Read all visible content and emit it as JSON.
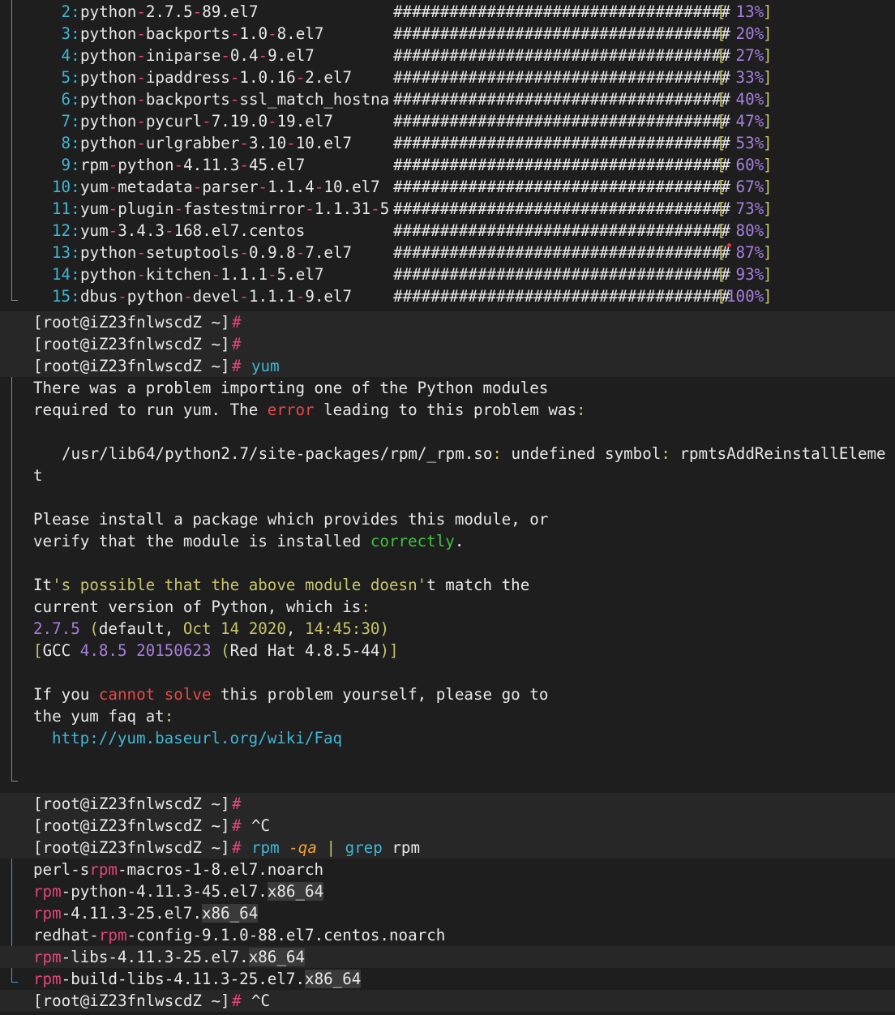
{
  "install_progress": [
    {
      "num": " 2:",
      "pkg": "python-2.7.5-89.el7",
      "bar": "####################################",
      "pct": " 13%"
    },
    {
      "num": " 3:",
      "pkg": "python-backports-1.0-8.el7",
      "bar": "####################################",
      "pct": " 20%"
    },
    {
      "num": " 4:",
      "pkg": "python-iniparse-0.4-9.el7",
      "bar": "####################################",
      "pct": " 27%"
    },
    {
      "num": " 5:",
      "pkg": "python-ipaddress-1.0.16-2.el7",
      "bar": "####################################",
      "pct": " 33%"
    },
    {
      "num": " 6:",
      "pkg": "python-backports-ssl_match_hostna",
      "bar": "####################################",
      "pct": " 40%"
    },
    {
      "num": " 7:",
      "pkg": "python-pycurl-7.19.0-19.el7",
      "bar": "####################################",
      "pct": " 47%"
    },
    {
      "num": " 8:",
      "pkg": "python-urlgrabber-3.10-10.el7",
      "bar": "####################################",
      "pct": " 53%"
    },
    {
      "num": " 9:",
      "pkg": "rpm-python-4.11.3-45.el7",
      "bar": "####################################",
      "pct": " 60%"
    },
    {
      "num": "10:",
      "pkg": "yum-metadata-parser-1.1.4-10.el7",
      "bar": "####################################",
      "pct": " 67%"
    },
    {
      "num": "11:",
      "pkg": "yum-plugin-fastestmirror-1.1.31-5",
      "bar": "####################################",
      "pct": " 73%"
    },
    {
      "num": "12:",
      "pkg": "yum-3.4.3-168.el7.centos",
      "bar": "####################################",
      "pct": " 80%"
    },
    {
      "num": "13:",
      "pkg": "python-setuptools-0.9.8-7.el7",
      "bar": "####################################",
      "pct": " 87%"
    },
    {
      "num": "14:",
      "pkg": "python-kitchen-1.1.1-5.el7",
      "bar": "####################################",
      "pct": " 93%"
    },
    {
      "num": "15:",
      "pkg": "dbus-python-devel-1.1.1-9.el7",
      "bar": "####################################",
      "pct": "100%"
    }
  ],
  "prompt": "[root@iZ23fnlwscdZ ~]",
  "hash": "#",
  "cmd_yum": "yum",
  "yum_error": {
    "l1": "There was a problem importing one of the Python modules",
    "l2a": "required to run yum. The ",
    "l2b": "error",
    "l2c": " leading to this problem was",
    "colon": ":",
    "path": "/usr/lib64/python2.7/site-packages/rpm/_rpm.so",
    "undef": " undefined symbol",
    "sym": " rpmtsAddReinstallEleme",
    "wrap": "t",
    "p1": "Please install a package which provides this module, or",
    "p2a": "verify that the module is installed ",
    "p2b": "correctly",
    "p2c": ".",
    "q1a": "It",
    "q1b": "'s possible that the above module doesn'",
    "q1c": "t match the",
    "q2a": "current version of Python, which is",
    "q2b": ":",
    "v1a": "2.7.5",
    "v1b": " (",
    "v1c": "default, ",
    "v1d": "Oct 14 2020",
    "v1e": ", ",
    "v1f": "14:45:30",
    "v1g": ")",
    "g1a": "[",
    "g1b": "GCC ",
    "g1c": "4.8.5 20150623",
    "g1d": " (",
    "g1e": "Red Hat 4.8.5-44",
    "g1f": ")]",
    "s1a": "If you ",
    "s1b": "cannot solve",
    "s1c": " this problem yourself, please go to",
    "s2a": "the yum faq at",
    "s2b": ":",
    "url": "http://yum.baseurl.org/wiki/Faq"
  },
  "ctrl_c": "^C",
  "cmd_rpm": {
    "rpm": "rpm",
    "flag": "-qa",
    "pipe": "|",
    "grep": "grep",
    "arg": "rpm"
  },
  "rpm_results": [
    {
      "a": "perl-s",
      "b": "rpm",
      "c": "-macros-1-8.el7.noarch",
      "sel": ""
    },
    {
      "a": "",
      "b": "rpm",
      "c": "-python-4.11.3-45.el7.",
      "sel": "x86_64"
    },
    {
      "a": "",
      "b": "rpm",
      "c": "-4.11.3-25.el7.",
      "sel": "x86_64"
    },
    {
      "a": "redhat-",
      "b": "rpm",
      "c": "-config-9.1.0-88.el7.centos.noarch",
      "sel": ""
    },
    {
      "a": "",
      "b": "rpm",
      "c": "-libs-4.11.3-25.el7.",
      "sel": "x86_64"
    },
    {
      "a": "",
      "b": "rpm",
      "c": "-build-libs-4.11.3-25.el7.",
      "sel": "x86_64"
    }
  ],
  "colors": {
    "background": "#1e1e1e",
    "prompt_hash": "#e6447a",
    "command": "#3fb6d6",
    "percent": "#a87fe0",
    "error": "#e64848",
    "ok": "#3fc23f"
  }
}
